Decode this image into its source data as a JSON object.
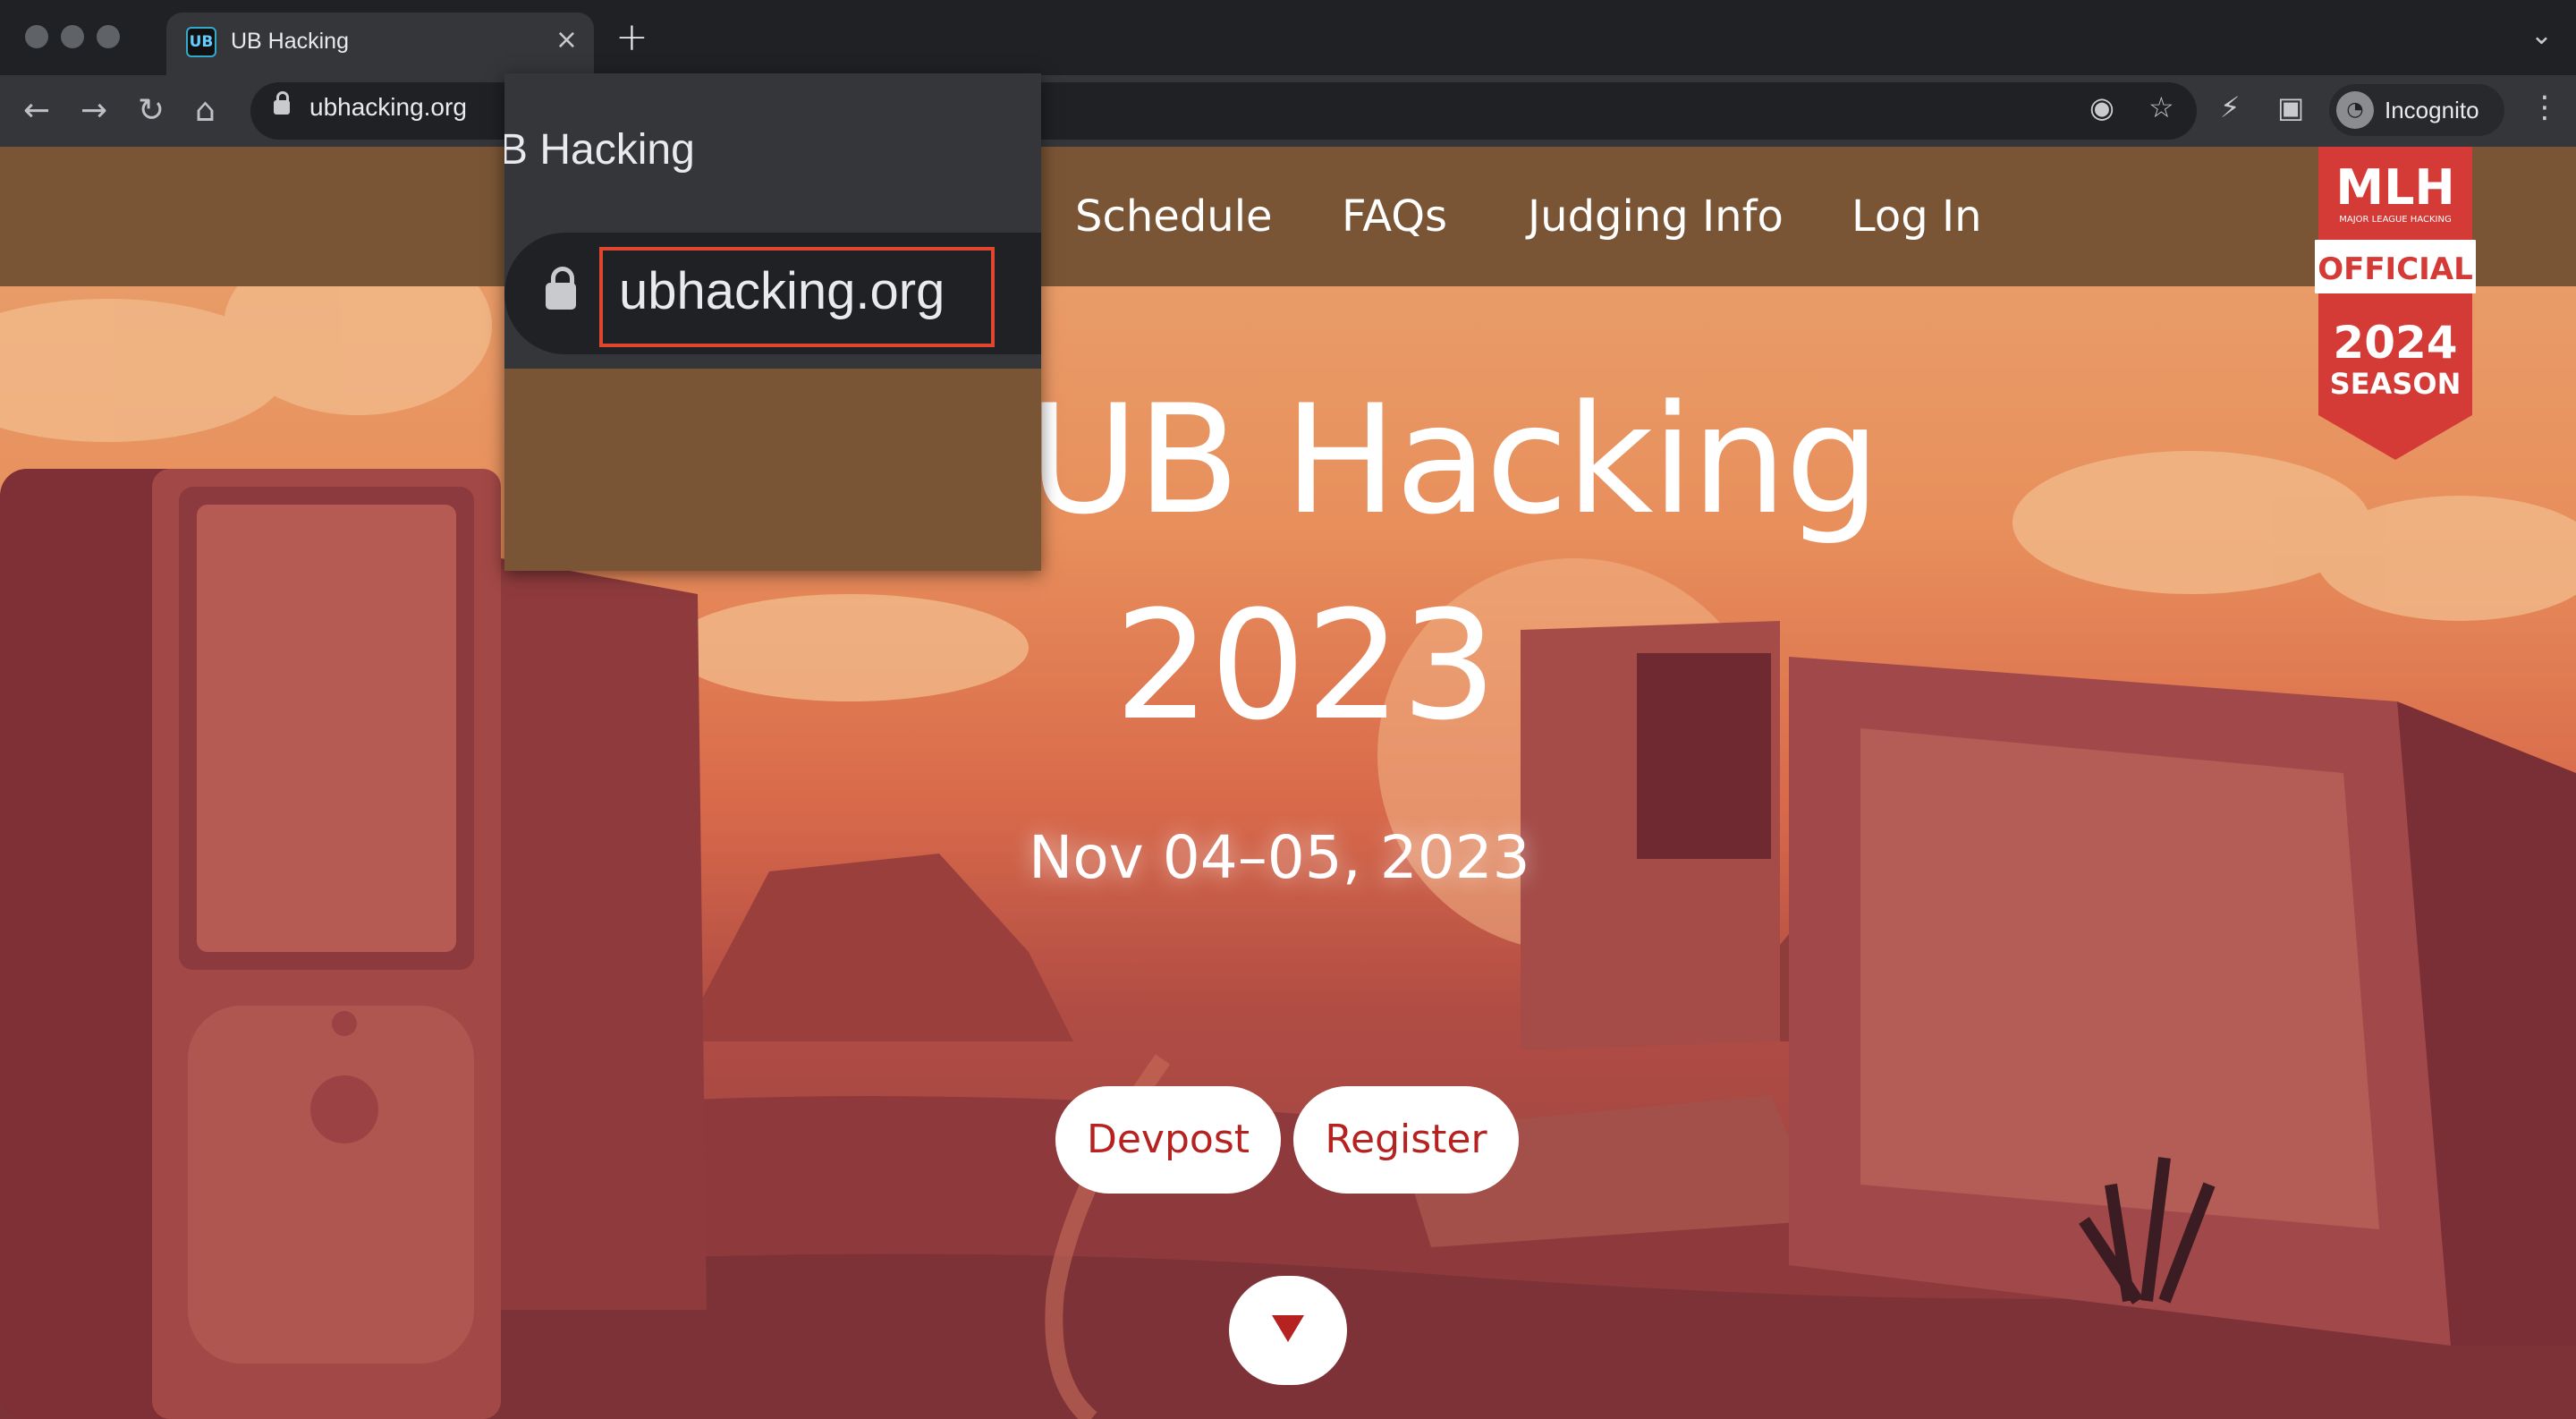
{
  "browser": {
    "tab_title": "UB Hacking",
    "favicon_text": "UB",
    "close_glyph": "×",
    "newtab_glyph": "+",
    "url": "ubhacking.org",
    "profile_label": "Incognito"
  },
  "site": {
    "nav": [
      "Schedule",
      "FAQs",
      "Judging Info",
      "Log In"
    ],
    "hero_title": "UB Hacking",
    "hero_year": "2023",
    "hero_date": "Nov 04–05, 2023",
    "buttons": [
      "Devpost",
      "Register"
    ],
    "badge": {
      "line1": "MLH",
      "line2": "MAJOR LEAGUE HACKING",
      "line3": "OFFICIAL",
      "line4": "2024",
      "line5": "SEASON"
    }
  },
  "zoom": {
    "title": "B Hacking",
    "url": "ubhacking.org"
  },
  "colors": {
    "navbar": "#7a5535",
    "accent_red": "#b62220",
    "highlight_box": "#e0452e"
  }
}
